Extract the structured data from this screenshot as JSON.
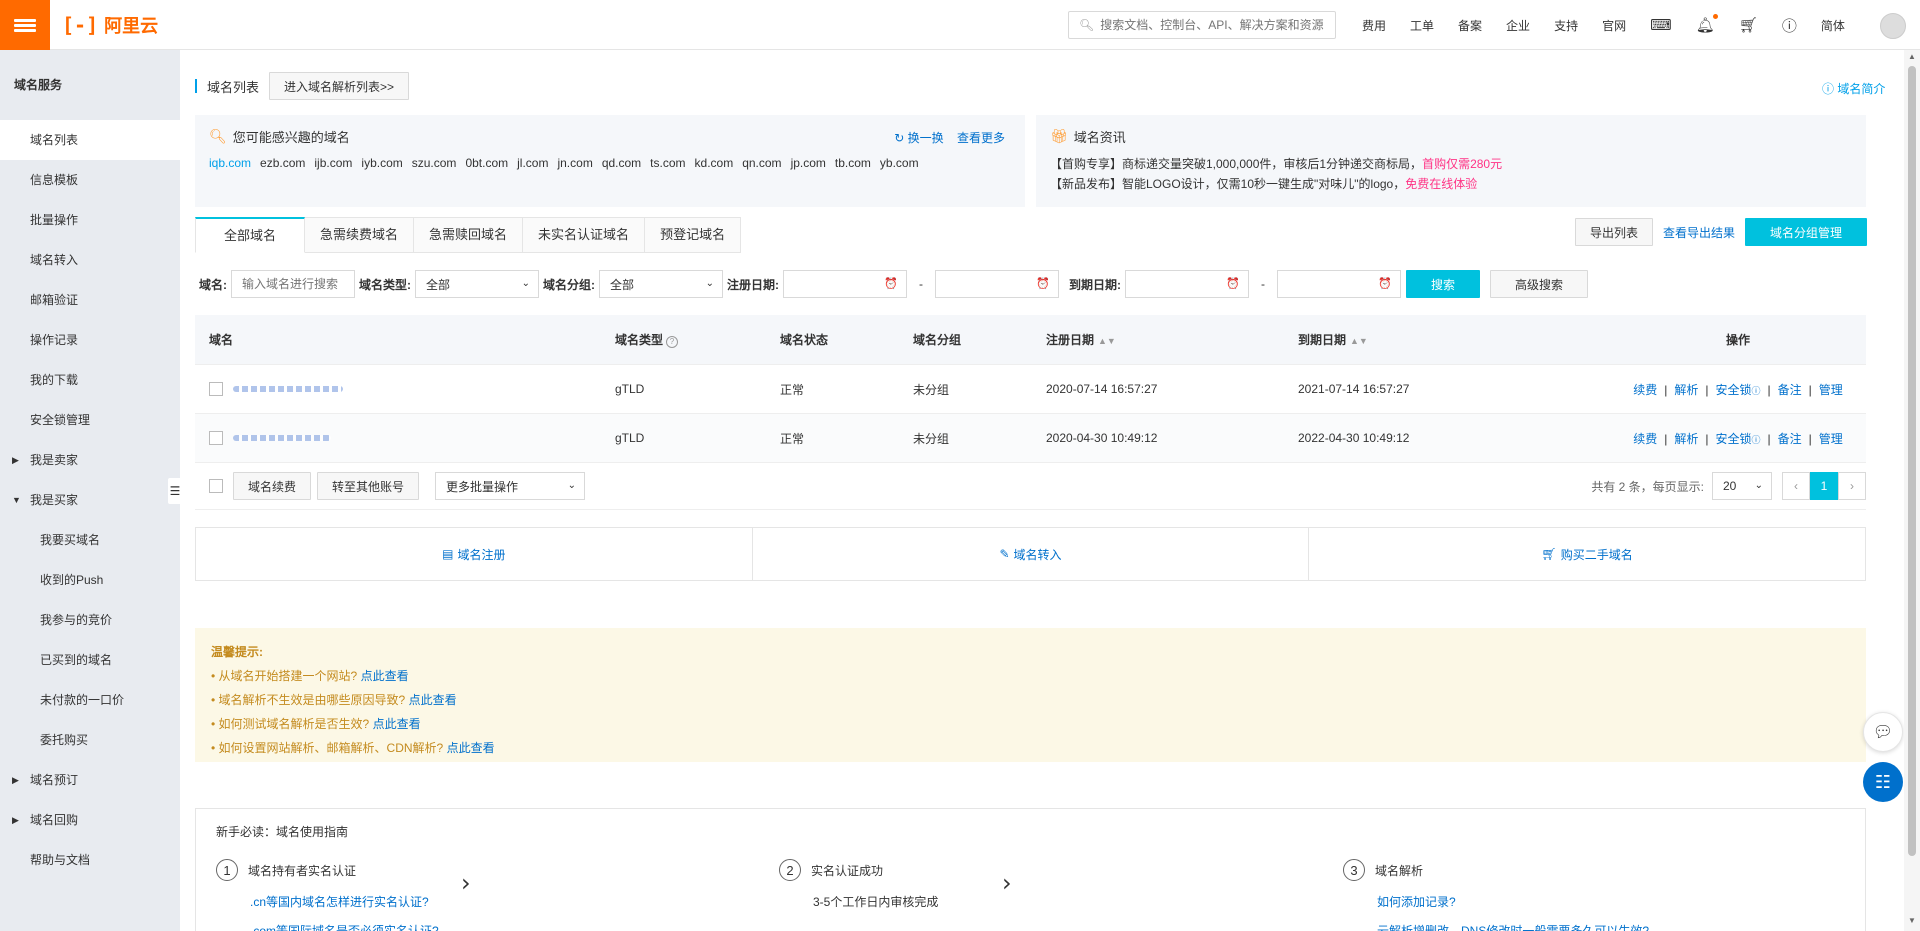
{
  "topbar": {
    "logo_text": "阿里云",
    "logo_mark": "[-]",
    "search_placeholder": "搜索文档、控制台、API、解决方案和资源",
    "nav": [
      "费用",
      "工单",
      "备案",
      "企业",
      "支持",
      "官网"
    ],
    "lang": "简体"
  },
  "sidebar": {
    "title": "域名服务",
    "items": [
      {
        "label": "域名列表",
        "active": true
      },
      {
        "label": "信息模板"
      },
      {
        "label": "批量操作"
      },
      {
        "label": "域名转入"
      },
      {
        "label": "邮箱验证"
      },
      {
        "label": "操作记录"
      },
      {
        "label": "我的下载"
      },
      {
        "label": "安全锁管理"
      }
    ],
    "seller": "我是卖家",
    "buyer": "我是买家",
    "buyer_items": [
      "我要买域名",
      "收到的Push",
      "我参与的竞价",
      "已买到的域名",
      "未付款的一口价",
      "委托购买"
    ],
    "preorder": "域名预订",
    "buyback": "域名回购",
    "help": "帮助与文档"
  },
  "header": {
    "title": "域名列表",
    "goto_dns": "进入域名解析列表>>",
    "intro": "域名简介"
  },
  "interest": {
    "title": "您可能感兴趣的域名",
    "refresh": "换一换",
    "more": "查看更多",
    "domains": [
      "iqb.com",
      "ezb.com",
      "ijb.com",
      "iyb.com",
      "szu.com",
      "0bt.com",
      "jl.com",
      "jn.com",
      "qd.com",
      "ts.com",
      "kd.com",
      "qn.com",
      "jp.com",
      "tb.com",
      "yb.com"
    ]
  },
  "news": {
    "title": "域名资讯",
    "line1": "【首购专享】商标递交量突破1,000,000件，审核后1分钟递交商标局，",
    "line1_link": "首购仅需280元",
    "line2": "【新品发布】智能LOGO设计，仅需10秒一键生成\"对味儿\"的logo，",
    "line2_link": "免费在线体验"
  },
  "tabs": [
    "全部域名",
    "急需续费域名",
    "急需赎回域名",
    "未实名认证域名",
    "预登记域名"
  ],
  "tools": {
    "export": "导出列表",
    "view_export": "查看导出结果",
    "group_manage": "域名分组管理"
  },
  "filters": {
    "domain_label": "域名:",
    "domain_placeholder": "输入域名进行搜索",
    "type_label": "域名类型:",
    "type_value": "全部",
    "group_label": "域名分组:",
    "group_value": "全部",
    "reg_label": "注册日期:",
    "exp_label": "到期日期:",
    "dash": "-",
    "search": "搜索",
    "advanced": "高级搜索"
  },
  "table": {
    "headers": [
      "域名",
      "域名类型",
      "域名状态",
      "域名分组",
      "注册日期",
      "到期日期",
      "操作"
    ],
    "rows": [
      {
        "type": "gTLD",
        "status": "正常",
        "group": "未分组",
        "reg": "2020-07-14 16:57:27",
        "exp": "2021-07-14 16:57:27"
      },
      {
        "type": "gTLD",
        "status": "正常",
        "group": "未分组",
        "reg": "2020-04-30 10:49:12",
        "exp": "2022-04-30 10:49:12"
      }
    ],
    "ops": [
      "续费",
      "解析",
      "安全锁",
      "备注",
      "管理"
    ]
  },
  "footer": {
    "renew": "域名续费",
    "transfer": "转至其他账号",
    "batch": "更多批量操作",
    "total": "共有 2 条，每页显示:",
    "page_size": "20",
    "current_page": "1"
  },
  "quick": [
    "域名注册",
    "域名转入",
    "购买二手域名"
  ],
  "tips": {
    "title": "温馨提示:",
    "items": [
      {
        "text": "• 从域名开始搭建一个网站?",
        "link": "点此查看"
      },
      {
        "text": "• 域名解析不生效是由哪些原因导致?",
        "link": "点此查看"
      },
      {
        "text": "• 如何测试域名解析是否生效?",
        "link": "点此查看"
      },
      {
        "text": "• 如何设置网站解析、邮箱解析、CDN解析?",
        "link": "点此查看"
      }
    ]
  },
  "guide": {
    "title": "新手必读：域名使用指南",
    "step1": {
      "num": "1",
      "title": "域名持有者实名认证",
      "l1": ".cn等国内域名怎样进行实名认证?",
      "l2": ".com等国际域名是否必须实名认证?"
    },
    "step2": {
      "num": "2",
      "title": "实名认证成功",
      "l1": "3-5个工作日内审核完成"
    },
    "step3": {
      "num": "3",
      "title": "域名解析",
      "l1": "如何添加记录?",
      "l2": "云解析增删改、DNS修改时一般需要多久可以生效?"
    }
  },
  "colors": {
    "brand": "#ff6a00",
    "primary": "#00c1de",
    "link": "#0070cc"
  }
}
